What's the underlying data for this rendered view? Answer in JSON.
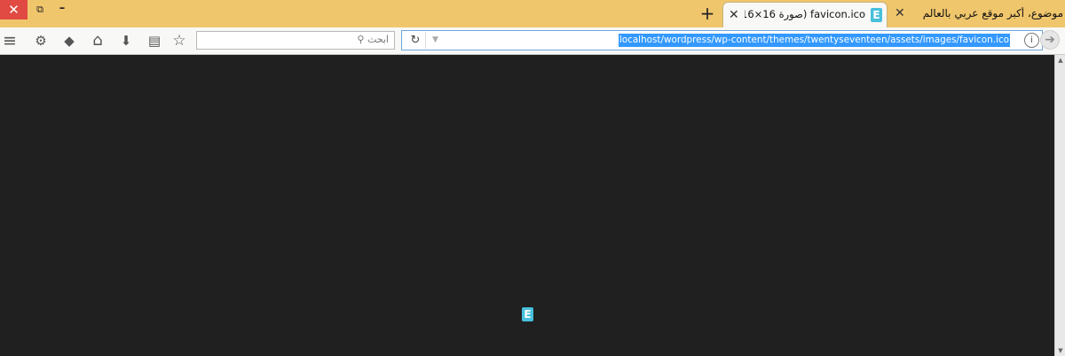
{
  "window": {
    "close_glyph": "✕",
    "restore_glyph": "⧉",
    "minimize_glyph": "–"
  },
  "tabs": {
    "new_tab_glyph": "+",
    "active": {
      "title": "favicon.ico (صورة ICON، 16×16)",
      "favicon_letter": "E",
      "close_glyph": "✕"
    },
    "inactive": {
      "title": "موضوع، أكبر موقع عربي بالعالم",
      "close_glyph": "✕"
    }
  },
  "toolbar": {
    "menu_icon": "≡",
    "customize_icon": "⚙",
    "pocket_icon": "◆",
    "home_icon": "⌂",
    "download_icon": "⬇",
    "library_icon": "▤",
    "bookmark_icon": "☆"
  },
  "search": {
    "placeholder": "ابحث"
  },
  "urlbar": {
    "url": "localhost/wordpress/wp-content/themes/twentyseventeen/assets/images/favicon.ico",
    "reload_icon": "↻",
    "dropdown_icon": "▼",
    "info_icon": "i",
    "go_icon": "➔"
  },
  "content": {
    "image_letter": "E"
  },
  "colors": {
    "tabbar": "#f0c66c",
    "content_bg": "#202020",
    "favicon": "#47c0dc",
    "selection": "#3399ff"
  }
}
